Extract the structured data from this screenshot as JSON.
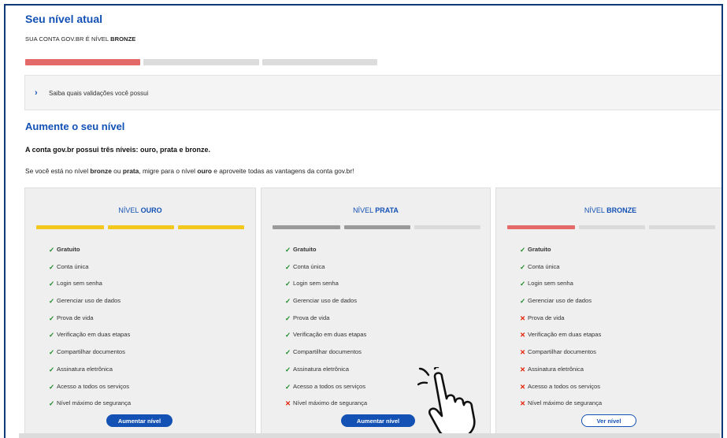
{
  "header": {
    "title": "Seu nível atual",
    "account_prefix": "SUA CONTA GOV.BR É NÍVEL ",
    "account_level": "BRONZE"
  },
  "current_level_bars": [
    "#e46a6a",
    "#dcdcdc",
    "#dcdcdc"
  ],
  "accordion": {
    "label": "Saiba quais validações você possui"
  },
  "increase": {
    "title": "Aumente o seu nível",
    "intro": "A conta gov.br possui três níveis: ouro, prata e bronze.",
    "sub_1": "Se você está no nível ",
    "sub_bronze": "bronze",
    "sub_2": " ou ",
    "sub_prata": "prata",
    "sub_3": ", migre para o nível ",
    "sub_ouro": "ouro",
    "sub_4": " e aproveite todas as vantagens da conta gov.br!"
  },
  "colors": {
    "ouro": "#f2c81e",
    "prata": "#9a9a9a",
    "bronze": "#e46a6a",
    "empty": "#dadada",
    "primary": "#1351b4"
  },
  "cards": [
    {
      "prefix": "NÍVEL ",
      "name": "OURO",
      "features": [
        {
          "label": "Gratuito",
          "ok": true
        },
        {
          "label": "Conta única",
          "ok": true
        },
        {
          "label": "Login sem senha",
          "ok": true
        },
        {
          "label": "Gerenciar uso de dados",
          "ok": true
        },
        {
          "label": "Prova de vida",
          "ok": true
        },
        {
          "label": "Verificação em duas etapas",
          "ok": true
        },
        {
          "label": "Compartilhar documentos",
          "ok": true
        },
        {
          "label": "Assinatura eletrônica",
          "ok": true
        },
        {
          "label": "Acesso a todos os serviços",
          "ok": true
        },
        {
          "label": "Nível máximo de segurança",
          "ok": true
        }
      ],
      "button": "Aumentar nível"
    },
    {
      "prefix": "NÍVEL ",
      "name": "PRATA",
      "features": [
        {
          "label": "Gratuito",
          "ok": true
        },
        {
          "label": "Conta única",
          "ok": true
        },
        {
          "label": "Login sem senha",
          "ok": true
        },
        {
          "label": "Gerenciar uso de dados",
          "ok": true
        },
        {
          "label": "Prova de vida",
          "ok": true
        },
        {
          "label": "Verificação em duas etapas",
          "ok": true
        },
        {
          "label": "Compartilhar documentos",
          "ok": true
        },
        {
          "label": "Assinatura eletrônica",
          "ok": true
        },
        {
          "label": "Acesso a todos os serviços",
          "ok": true
        },
        {
          "label": "Nível máximo de segurança",
          "ok": false
        }
      ],
      "button": "Aumentar nível"
    },
    {
      "prefix": "NÍVEL ",
      "name": "BRONZE",
      "features": [
        {
          "label": "Gratuito",
          "ok": true
        },
        {
          "label": "Conta única",
          "ok": true
        },
        {
          "label": "Login sem senha",
          "ok": true
        },
        {
          "label": "Gerenciar uso de dados",
          "ok": true
        },
        {
          "label": "Prova de vida",
          "ok": false
        },
        {
          "label": "Verificação em duas etapas",
          "ok": false
        },
        {
          "label": "Compartilhar documentos",
          "ok": false
        },
        {
          "label": "Assinatura eletrônica",
          "ok": false
        },
        {
          "label": "Acesso a todos os serviços",
          "ok": false
        },
        {
          "label": "Nível máximo de segurança",
          "ok": false
        }
      ],
      "button": "Ver nível"
    }
  ],
  "icons": {
    "ok": "✓",
    "no": "✕",
    "chevron": "›",
    "cursor": "hand-pointer-icon"
  }
}
